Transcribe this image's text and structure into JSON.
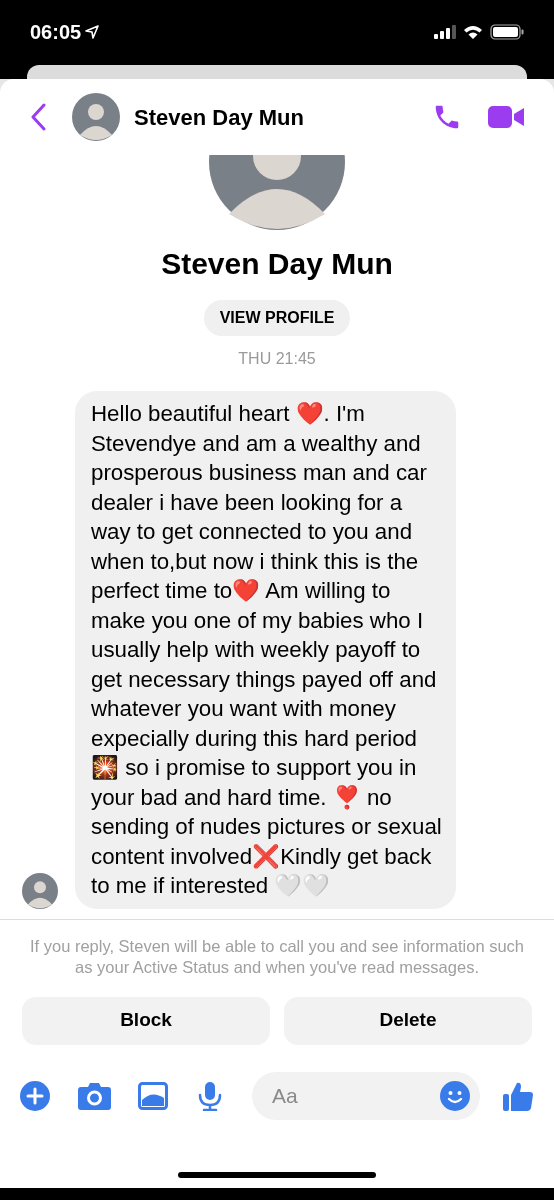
{
  "status_bar": {
    "time": "06:05"
  },
  "header": {
    "name": "Steven Day Mun"
  },
  "profile": {
    "name": "Steven Day Mun",
    "button": "VIEW PROFILE"
  },
  "timestamp": "THU 21:45",
  "message": {
    "text": "Hello beautiful heart ❤️. I'm Stevendye and am a wealthy and prosperous business man and car dealer i have been looking for a way to get connected to you and when to,but now i think this is the perfect time to❤️ Am willing to make you one of my babies who I usually help with weekly payoff to get necessary things payed off and whatever you want with money expecially during this hard period 🎇 so i promise to support you in your bad and hard time. ❣️ no sending of nudes pictures or sexual content involved❌Kindly get back to me if interested 🤍🤍"
  },
  "notice": "If you reply, Steven will be able to call you and see information such as your Active Status and when you've read messages.",
  "actions": [
    {
      "label": "Block"
    },
    {
      "label": "Delete"
    }
  ],
  "composer": {
    "placeholder": "Aa"
  }
}
